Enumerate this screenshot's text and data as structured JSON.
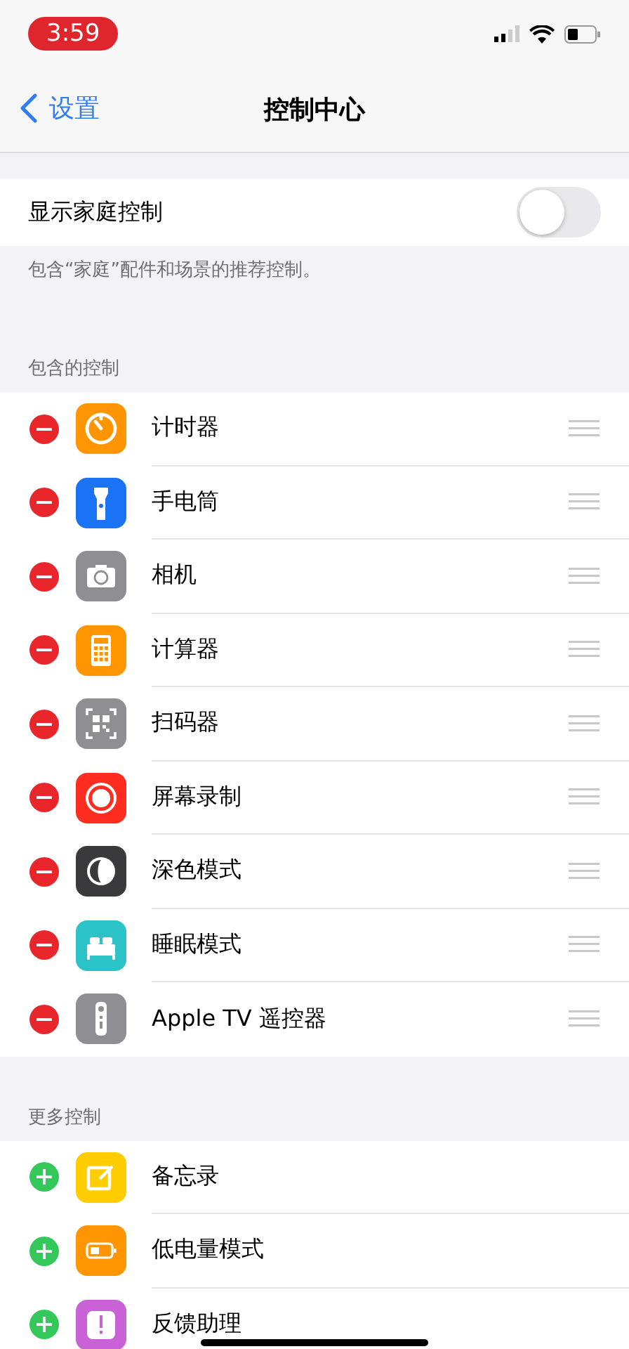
{
  "status_bar": {
    "time": "3:59"
  },
  "nav": {
    "back": "设置",
    "title": "控制中心"
  },
  "home_toggle": {
    "label": "显示家庭控制",
    "on": false,
    "footer": "包含“家庭”配件和场景的推荐控制。"
  },
  "sections": [
    {
      "header": "包含的控制",
      "items": [
        {
          "label": "计时器",
          "kind": "remove",
          "color": "#ff9500"
        },
        {
          "label": "手电筒",
          "kind": "remove",
          "color": "#1a73f5"
        },
        {
          "label": "相机",
          "kind": "remove",
          "color": "#8e8e93"
        },
        {
          "label": "计算器",
          "kind": "remove",
          "color": "#ff9500"
        },
        {
          "label": "扫码器",
          "kind": "remove",
          "color": "#8e8e93"
        },
        {
          "label": "屏幕录制",
          "kind": "remove",
          "color": "#ff2d20"
        },
        {
          "label": "深色模式",
          "kind": "remove",
          "color": "#3a3a3c"
        },
        {
          "label": "睡眠模式",
          "kind": "remove",
          "color": "#2cc3c8"
        },
        {
          "label": "Apple TV 遥控器",
          "kind": "remove",
          "color": "#8e8e93"
        }
      ]
    },
    {
      "header": "更多控制",
      "items": [
        {
          "label": "备忘录",
          "kind": "add",
          "color": "#ffcc00"
        },
        {
          "label": "低电量模式",
          "kind": "add",
          "color": "#ff9500"
        },
        {
          "label": "反馈助理",
          "kind": "add",
          "color": "#c962d6"
        }
      ]
    }
  ]
}
